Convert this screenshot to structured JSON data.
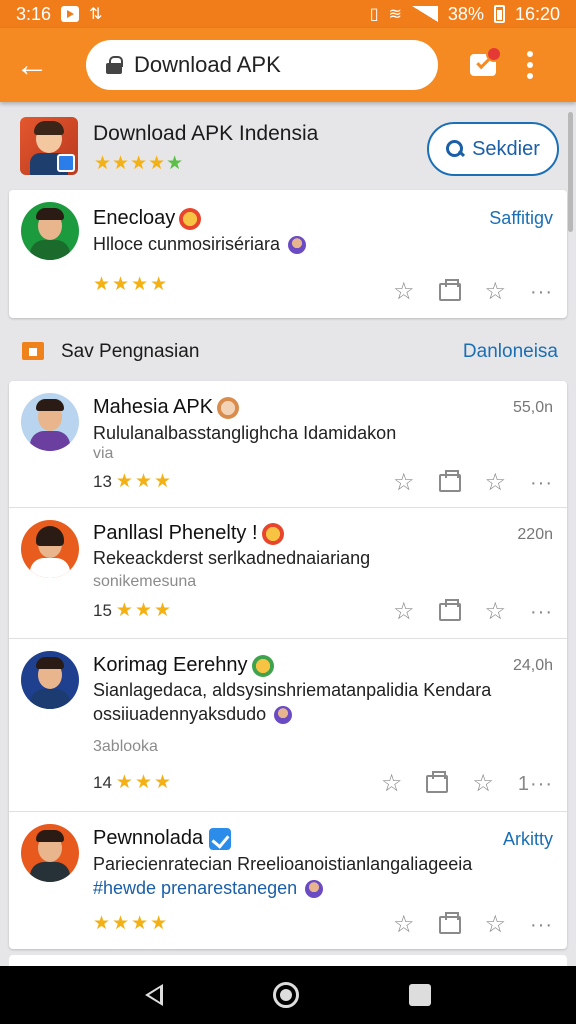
{
  "status_bar": {
    "time_left": "3:16",
    "battery": "38%",
    "time_right": "16:20"
  },
  "toolbar": {
    "url_text": "Download APK"
  },
  "app": {
    "title": "Download APK Indensia",
    "stars": "★★★★",
    "search_label": "Sekdier"
  },
  "featured": {
    "name": "Enecloay",
    "action": "Saffitigv",
    "text": "Hlloce cunmosirisériara",
    "stars": "★★★★"
  },
  "section": {
    "title": "Sav Pengnasian",
    "link": "Danloneisa"
  },
  "feed": [
    {
      "name": "Mahesia APK",
      "text": "Rululanalbasstanglighcha Idamidakon",
      "sub": "via",
      "count": "13",
      "stars": "★★★",
      "time": "55,0n",
      "more": "···"
    },
    {
      "name": "Panllasl Phenelty !",
      "text": "Rekeackderst serlkadnednaiariang",
      "sub": "sonikemesuna",
      "count": "15",
      "stars": "★★★",
      "time": "220n",
      "more": "···"
    },
    {
      "name": "Korimag Eerehny",
      "text": "Sianlagedaca, aldsysinshriematanpalidia Kendara",
      "text2": "ossiiuadennyaksdudo",
      "sub": "3ablooka",
      "count": "14",
      "stars": "★★★",
      "time": "24,0h",
      "more": "1···"
    },
    {
      "name": "Pewnnolada",
      "text": "Pariecienratecian Rreelioanoistianlangaliageeia",
      "text2": "#hewde prenarestanegen",
      "stars": "★★★★",
      "action": "Arkitty",
      "more": "···"
    }
  ],
  "colors": {
    "accent": "#f58a22",
    "link": "#1a6fb5",
    "star": "#f3b116"
  }
}
